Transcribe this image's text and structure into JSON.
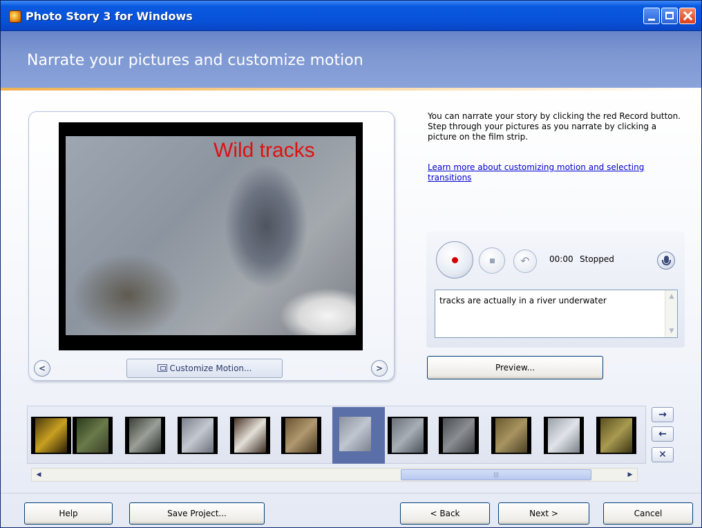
{
  "window": {
    "title": "Photo Story 3 for Windows"
  },
  "header": {
    "title": "Narrate your pictures and customize motion"
  },
  "preview": {
    "overlay_text": "Wild tracks",
    "prev_label": "<",
    "next_label": ">",
    "customize_button": "Customize Motion..."
  },
  "instructions": {
    "text": "You can narrate your story by clicking the red Record button. Step through your pictures as you narrate by clicking a picture on the film strip.",
    "link": "Learn more about customizing motion and selecting transitions"
  },
  "narration": {
    "timer": "00:00",
    "status": "Stopped",
    "text": "tracks are actually in a river underwater",
    "preview_button": "Preview..."
  },
  "filmstrip": {
    "selected_index": 6,
    "thumbnails": [
      "thumb-1",
      "thumb-2",
      "thumb-3",
      "thumb-4",
      "thumb-5",
      "thumb-6",
      "thumb-7",
      "thumb-8",
      "thumb-9",
      "thumb-10",
      "thumb-11",
      "thumb-12"
    ],
    "move_right_label": "→",
    "move_left_label": "←",
    "remove_label": "✕"
  },
  "footer": {
    "help": "Help",
    "save_project": "Save Project...",
    "back": "< Back",
    "next": "Next >",
    "cancel": "Cancel"
  },
  "colors": {
    "title_bar": "#0751d8",
    "header_band": "#7d97d2",
    "overlay_text": "#e01010",
    "record_dot": "#d00000",
    "selected_thumb": "#5a6ea8",
    "link": "#0000cc"
  }
}
